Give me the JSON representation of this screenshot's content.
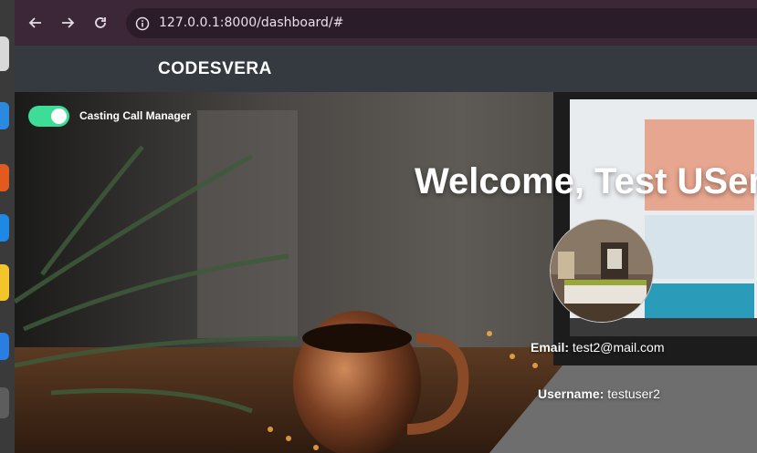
{
  "browser": {
    "url": "127.0.0.1:8000/dashboard/#"
  },
  "navbar": {
    "brand": "CODESVERA"
  },
  "toggle": {
    "label": "Casting Call Manager",
    "state": "on",
    "color": "#3ddc97"
  },
  "profile": {
    "welcome": "Welcome, Test USer",
    "email_label": "Email:",
    "email_value": "test2@mail.com",
    "username_label": "Username:",
    "username_value": "testuser2"
  },
  "colors": {
    "browser_bar": "#3b2738",
    "navbar": "#343a40"
  },
  "icons": [
    "back-arrow-icon",
    "forward-arrow-icon",
    "reload-icon",
    "site-info-icon"
  ]
}
